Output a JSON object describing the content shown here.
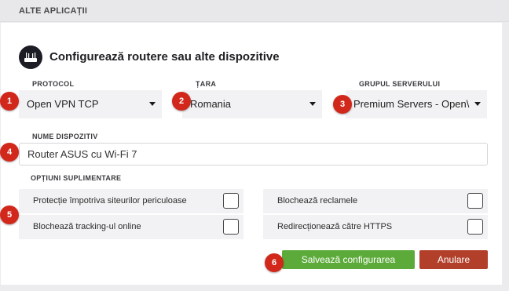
{
  "section_header": "ALTE APLICAȚII",
  "title": "Configurează routere sau alte dispozitive",
  "fields": {
    "protocol": {
      "label": "PROTOCOL",
      "value": "Open VPN TCP"
    },
    "country": {
      "label": "ȚARA",
      "value": "Romania"
    },
    "server_group": {
      "label": "GRUPUL SERVERULUI",
      "value": "Premium Servers - Open\\"
    },
    "device_name": {
      "label": "NUME DISPOZITIV",
      "value": "Router ASUS cu Wi-Fi 7"
    }
  },
  "options": {
    "label": "OPȚIUNI SUPLIMENTARE",
    "items": [
      {
        "label": "Protecție împotriva siteurilor periculoase",
        "checked": false
      },
      {
        "label": "Blochează reclamele",
        "checked": false
      },
      {
        "label": "Blochează tracking-ul online",
        "checked": false
      },
      {
        "label": "Redirecționează către HTTPS",
        "checked": false
      }
    ]
  },
  "buttons": {
    "save": "Salvează configurarea",
    "cancel": "Anulare"
  },
  "markers": [
    "1",
    "2",
    "3",
    "4",
    "5",
    "6"
  ],
  "colors": {
    "save": "#5cab3a",
    "cancel": "#b23f2a",
    "marker": "#d2281c"
  },
  "icons": {
    "logo": "router-logo-icon",
    "caret": "caret-down-icon"
  }
}
